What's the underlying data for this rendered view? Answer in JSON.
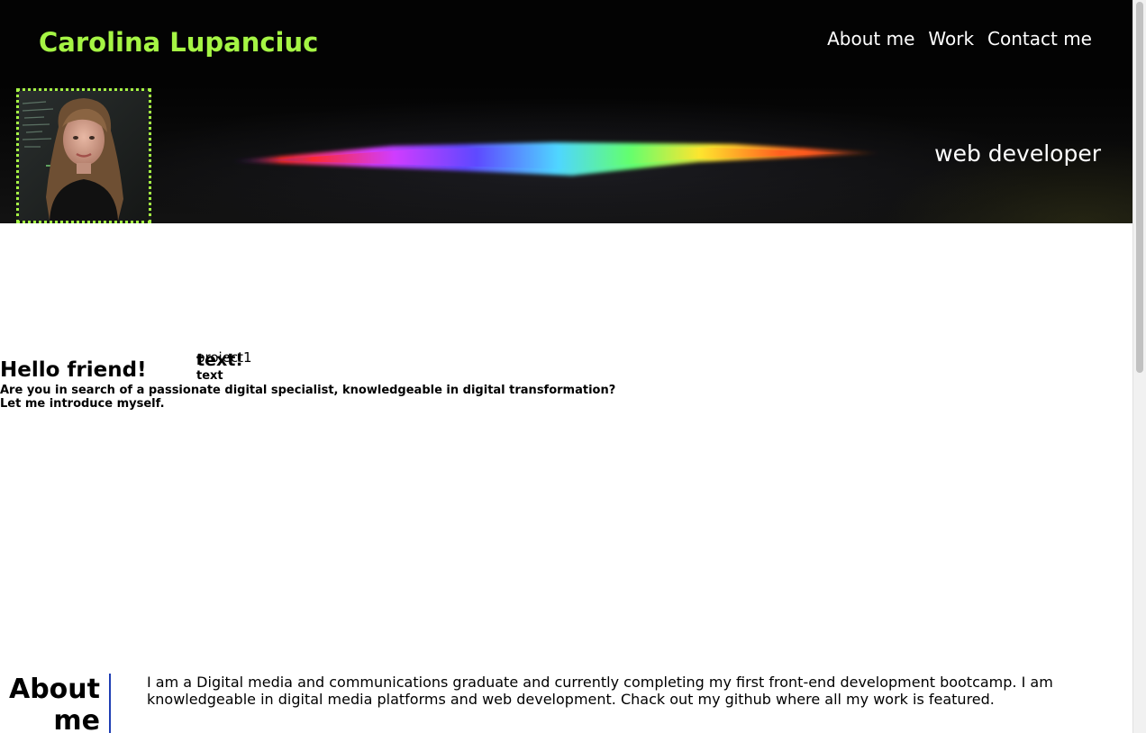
{
  "header": {
    "brand": "Carolina Lupanciuc",
    "nav": [
      {
        "label": "About me"
      },
      {
        "label": "Work"
      },
      {
        "label": "Contact me"
      }
    ],
    "tagline": "web developer",
    "accent_color": "#a5f544"
  },
  "hero": {
    "title": "Hello friend!",
    "lines": [
      "Are you in search of a passionate digital specialist, knowledgeable in digital transformation?",
      "Let me introduce myself."
    ]
  },
  "project": {
    "label": "project1",
    "overlap_text": "text!",
    "text": "text"
  },
  "about": {
    "heading": "About me",
    "body": "I am a Digital media and communications graduate and currently completing my first front-end development bootcamp. I am knowledgeable in digital media platforms and web development. Chack out my github where all my work is featured.",
    "divider_color": "#1f3fb4"
  },
  "icons": {
    "avatar": "profile-photo",
    "banner": "rainbow-light-streak"
  }
}
